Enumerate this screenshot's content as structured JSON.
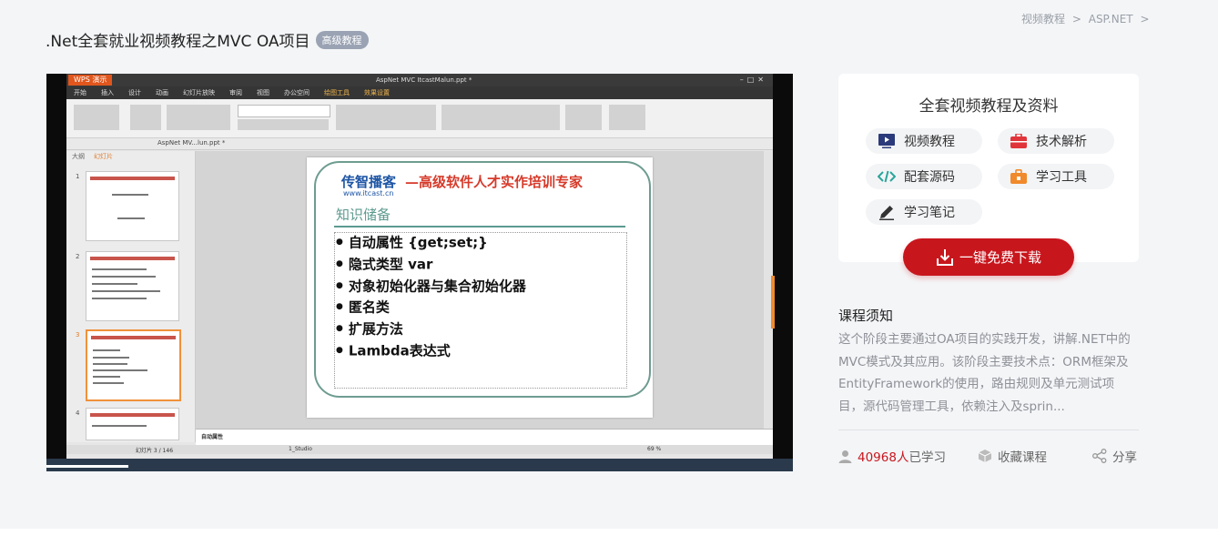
{
  "breadcrumb": [
    "视频教程",
    ">",
    "ASP.NET",
    ">"
  ],
  "course": {
    "title": ".Net全套就业视频教程之MVC OA项目",
    "level_badge": "高级教程"
  },
  "video": {
    "app_name": "WPS 演示",
    "file_name": "AspNet MVC ItcastMalun.ppt *",
    "menu": [
      "开始",
      "插入",
      "设计",
      "动画",
      "幻灯片放映",
      "审阅",
      "视图",
      "办公空间",
      "绘图工具",
      "效果设置"
    ],
    "doc_tab": "AspNet MV...lun.ppt *",
    "panel_tabs": [
      "大纲",
      "幻灯片"
    ],
    "thumb_numbers": [
      "1",
      "2",
      "3",
      "4"
    ],
    "slide": {
      "logo": "传智播客",
      "logo_url": "www.itcast.cn",
      "slogan": "—高级软件人才实作培训专家",
      "section": "知识储备",
      "bullets": [
        "自动属性 {get;set;}",
        "隐式类型 var",
        "对象初始化器与集合初始化器",
        "匿名类",
        "扩展方法",
        "Lambda表达式"
      ]
    },
    "notes_text": "自动属性",
    "status_slide": "幻灯片 3 / 146",
    "status_theme": "1_Studio",
    "zoom": "69 %"
  },
  "sidebar": {
    "title": "全套视频教程及资料",
    "tags": [
      {
        "label": "视频教程",
        "icon": "video-icon"
      },
      {
        "label": "技术解析",
        "icon": "briefcase-icon"
      },
      {
        "label": "配套源码",
        "icon": "code-icon"
      },
      {
        "label": "学习工具",
        "icon": "toolbox-icon"
      },
      {
        "label": "学习笔记",
        "icon": "pencil-icon"
      }
    ],
    "download_label": "一键免费下载",
    "notice_title": "课程须知",
    "notice_text": "这个阶段主要通过OA项目的实践开发，讲解.NET中的MVC模式及其应用。该阶段主要技术点：ORM框架及EntityFramework的使用，路由规则及单元测试项目，源代码管理工具，依赖注入及sprin...",
    "learners_count": "40968人",
    "learners_suffix": "已学习",
    "favorite_label": "收藏课程",
    "share_label": "分享"
  },
  "colors": {
    "accent": "#c8161d",
    "badge": "#9aa3b3",
    "background": "#f4f5f7"
  }
}
